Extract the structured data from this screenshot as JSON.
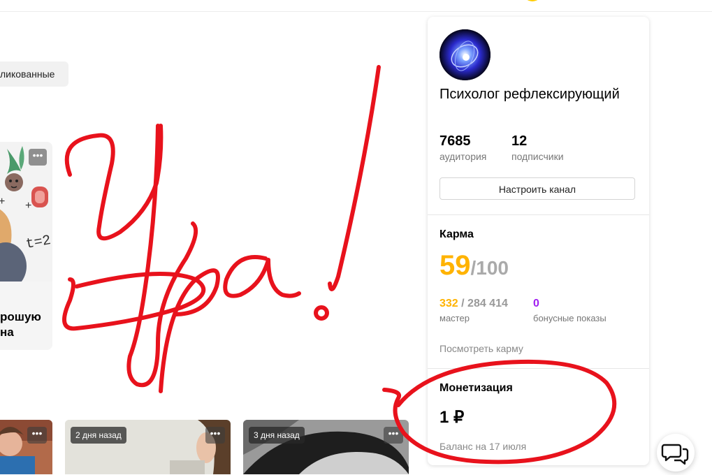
{
  "filters": {
    "published_label": "ликованные"
  },
  "cards": {
    "featured": {
      "title_line1": "рошую",
      "title_line2": "на",
      "menu": "•••"
    },
    "thumbs": [
      {
        "ago": "",
        "menu": "•••"
      },
      {
        "ago": "2 дня назад",
        "menu": "•••"
      },
      {
        "ago": "3 дня назад",
        "menu": "•••"
      }
    ]
  },
  "channel": {
    "name": "Психолог рефлексирующий",
    "audience": {
      "value": "7685",
      "label": "аудитория"
    },
    "subscribers": {
      "value": "12",
      "label": "подписчики"
    },
    "settings_button": "Настроить канал"
  },
  "karma": {
    "title": "Карма",
    "value": "59",
    "max": "/100",
    "master": {
      "value": "332",
      "total": " / 284 414",
      "label": "мастер"
    },
    "bonus": {
      "value": "0",
      "label": "бонусные показы"
    },
    "link": "Посмотреть карму",
    "colors": {
      "value": "#ffb300",
      "bonus": "#a020f0",
      "max": "#aaaaaa"
    }
  },
  "monetization": {
    "title": "Монетизация",
    "amount": "1 ₽",
    "balance_note": "Баланс на 17 июля"
  },
  "annotation": {
    "text": "Ура!",
    "color": "#e8121c"
  },
  "icons": {
    "chat": "chat-bubbles-icon",
    "avatar": "avatar"
  }
}
